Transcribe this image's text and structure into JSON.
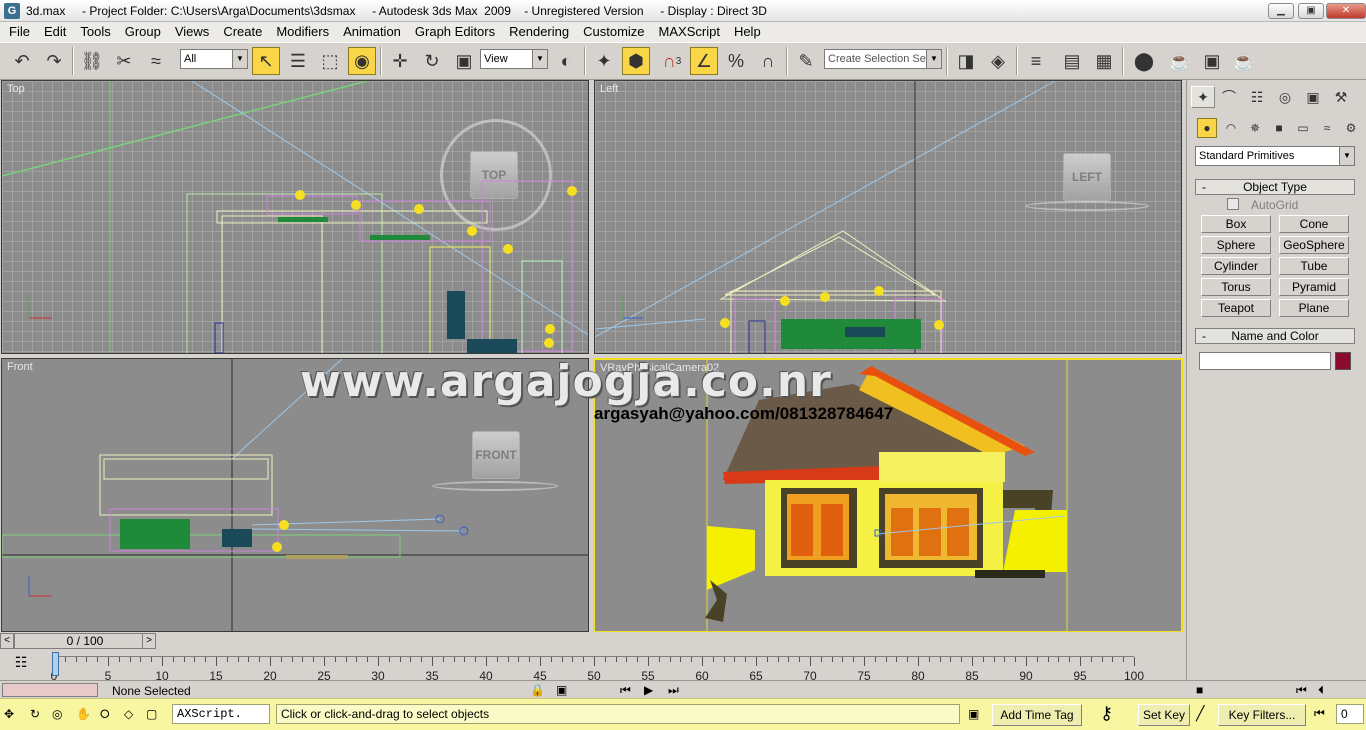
{
  "window": {
    "icon_letter": "G",
    "title": "3d.max     - Project Folder: C:\\Users\\Arga\\Documents\\3dsmax     - Autodesk 3ds Max  2009    - Unregistered Version     - Display : Direct 3D"
  },
  "window_controls": {
    "minimize": "▁",
    "maximize": "▣",
    "close": "✕"
  },
  "menu": [
    "File",
    "Edit",
    "Tools",
    "Group",
    "Views",
    "Create",
    "Modifiers",
    "Animation",
    "Graph Editors",
    "Rendering",
    "Customize",
    "MAXScript",
    "Help"
  ],
  "toolbar": {
    "selection_filter": "All",
    "ref_coord": "View",
    "named_selection_placeholder": "Create Selection Set",
    "snap_label": "3",
    "percent_label": "%"
  },
  "viewports": {
    "top": {
      "label": "Top",
      "cube": "TOP"
    },
    "left": {
      "label": "Left",
      "cube": "LEFT"
    },
    "front": {
      "label": "Front",
      "cube": "FRONT"
    },
    "camera": {
      "label": "VRayPhysicalCamera02"
    }
  },
  "overlay": {
    "watermark": "www.argajogja.co.nr",
    "contact": "argasyah@yahoo.com/081328784647"
  },
  "command_panel": {
    "category_dropdown": "Standard Primitives",
    "object_type": {
      "header": "Object Type",
      "autogrid": "AutoGrid",
      "buttons": [
        "Box",
        "Cone",
        "Sphere",
        "GeoSphere",
        "Cylinder",
        "Tube",
        "Torus",
        "Pyramid",
        "Teapot",
        "Plane"
      ]
    },
    "name_and_color": {
      "header": "Name and Color",
      "name_value": "",
      "color": "#8a0b2e"
    },
    "rollout_toggle": "-"
  },
  "time": {
    "slider_label": "0 / 100",
    "prev": "<",
    "next": ">",
    "ticks": [
      0,
      5,
      10,
      15,
      20,
      25,
      30,
      35,
      40,
      45,
      50,
      55,
      60,
      65,
      70,
      75,
      80,
      85,
      90,
      95,
      100
    ]
  },
  "status": {
    "selection": "None Selected",
    "maxscript": "AXScript.",
    "prompt": "Click or click-and-drag to select objects",
    "add_time_tag": "Add Time Tag",
    "set_key": "Set Key",
    "key_filters": "Key Filters...",
    "frame": "0"
  }
}
